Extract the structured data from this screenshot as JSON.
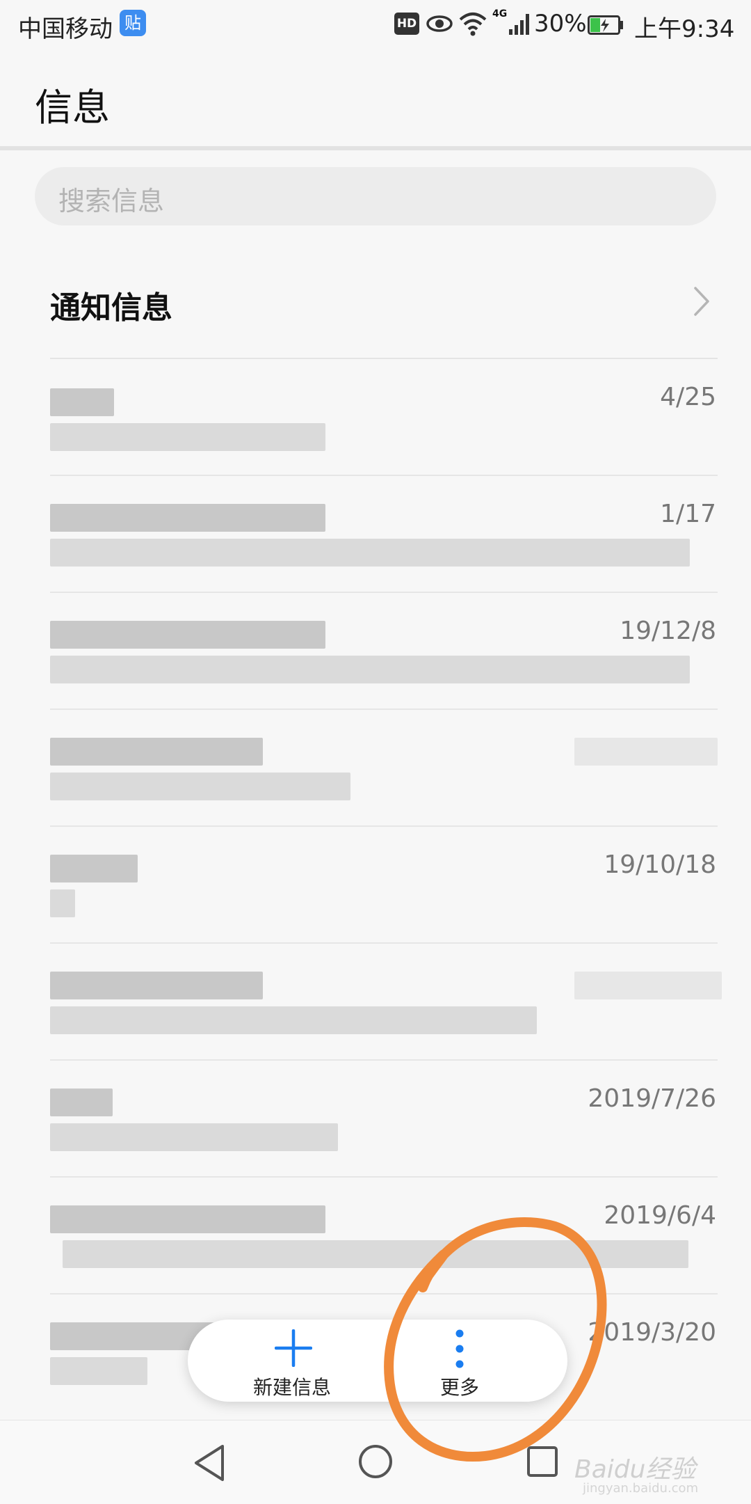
{
  "status_bar": {
    "carrier": "中国移动",
    "app_badge": "贴",
    "hd_badge": "HD",
    "network": "4G",
    "battery": "30%",
    "time": "上午9:34",
    "icons": [
      "eye-icon",
      "wifi-icon",
      "signal-icon",
      "battery-charging-icon"
    ]
  },
  "app_bar": {
    "title": "信息"
  },
  "search": {
    "placeholder": "搜索信息",
    "icon": "search-icon"
  },
  "notifications": {
    "label": "通知信息",
    "icon": "chevron-right-icon"
  },
  "conversations": [
    {
      "date": "4/25"
    },
    {
      "date": "1/17"
    },
    {
      "date": "19/12/8"
    },
    {
      "date": ""
    },
    {
      "date": "19/10/18"
    },
    {
      "date": ""
    },
    {
      "date": "2019/7/26"
    },
    {
      "date": "2019/6/4"
    },
    {
      "date": "2019/3/20"
    }
  ],
  "action_pill": {
    "new_message_label": "新建信息",
    "more_label": "更多",
    "new_icon": "plus-icon",
    "more_icon": "more-vertical-icon",
    "accent": "#1a7df0"
  },
  "nav_bar": {
    "icons": [
      "back-icon",
      "home-icon",
      "recents-icon"
    ]
  },
  "annotation_color": "#f08a3a",
  "watermark": {
    "brand": "Baidu经验",
    "url": "jingyan.baidu.com"
  }
}
